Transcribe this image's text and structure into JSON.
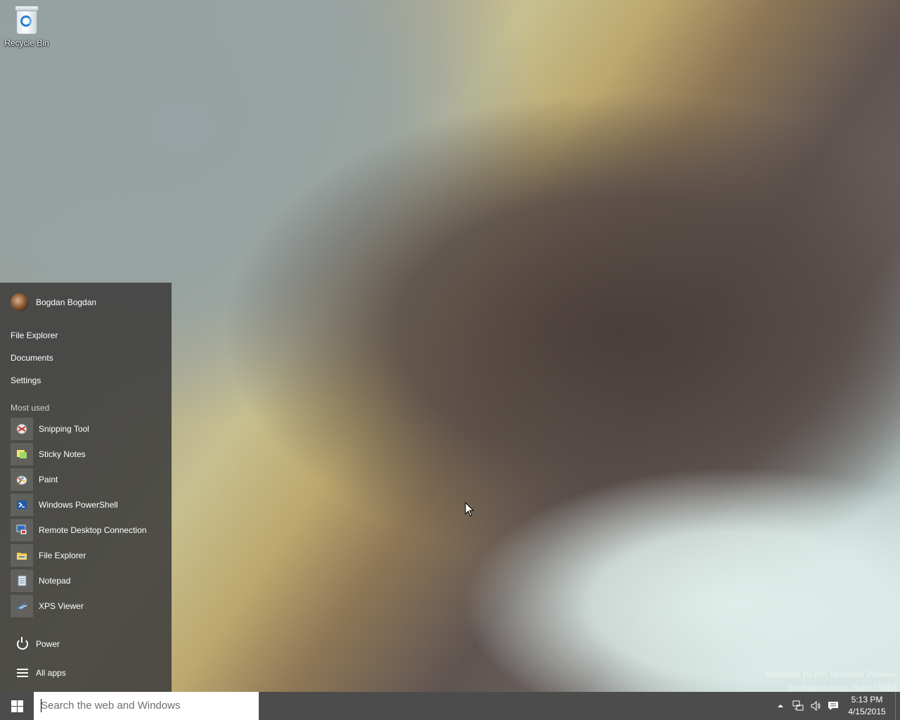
{
  "desktop": {
    "icons": [
      {
        "label": "Recycle Bin",
        "icon": "recycle-bin-icon"
      }
    ],
    "watermark": {
      "line1": "Windows 10 Pro Technical Preview",
      "line2": "Evaluation copy. Build 10056"
    }
  },
  "start_menu": {
    "user": {
      "name": "Bogdan Bogdan",
      "icon": "user-avatar"
    },
    "places": [
      {
        "label": "File Explorer"
      },
      {
        "label": "Documents"
      },
      {
        "label": "Settings"
      }
    ],
    "most_used_heading": "Most used",
    "apps": [
      {
        "label": "Snipping Tool",
        "icon": "snipping-tool-icon"
      },
      {
        "label": "Sticky Notes",
        "icon": "sticky-notes-icon"
      },
      {
        "label": "Paint",
        "icon": "paint-icon"
      },
      {
        "label": "Windows PowerShell",
        "icon": "powershell-icon"
      },
      {
        "label": "Remote Desktop Connection",
        "icon": "remote-desktop-icon"
      },
      {
        "label": "File Explorer",
        "icon": "folder-icon"
      },
      {
        "label": "Notepad",
        "icon": "notepad-icon"
      },
      {
        "label": "XPS Viewer",
        "icon": "xps-viewer-icon"
      }
    ],
    "power_label": "Power",
    "all_apps_label": "All apps"
  },
  "taskbar": {
    "search_placeholder": "Search the web and Windows",
    "tray_icons": [
      "chevron-up-icon",
      "network-icon",
      "volume-icon",
      "action-center-icon"
    ],
    "clock": {
      "time": "5:13 PM",
      "date": "4/15/2015"
    }
  },
  "colors": {
    "start_menu_bg": "#3e3e3c",
    "taskbar_bg": "#4c4c4c"
  }
}
